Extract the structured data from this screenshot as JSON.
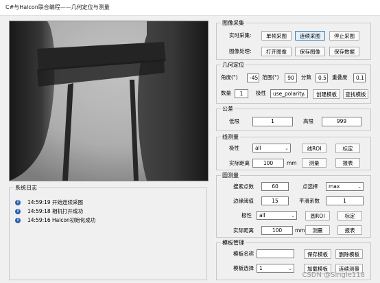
{
  "window": {
    "title": "C#与Halcon联合编程——几何定位与测量"
  },
  "log": {
    "title": "系统日志",
    "entries": [
      {
        "time": "14:59:19",
        "message": "开始连续采图"
      },
      {
        "time": "14:59:18",
        "message": "相机打开成功"
      },
      {
        "time": "14:59:16",
        "message": "Halcon初始化成功"
      }
    ]
  },
  "acquire": {
    "title": "图像采集",
    "realtime_label": "实时采集:",
    "single_btn": "单帧采图",
    "continuous_btn": "连续采图",
    "stop_btn": "停止采图",
    "process_label": "图像处理:",
    "open_btn": "打开图像",
    "save_img_btn": "保存图像",
    "save_data_btn": "保存数据"
  },
  "locate": {
    "title": "几何定位",
    "angle_label": "角度(°)",
    "angle_value": "-45",
    "range_label": "范围(°)",
    "range_value": "90",
    "score_label": "分数",
    "score_value": "0.5",
    "overlap_label": "重叠度",
    "overlap_value": "0.1",
    "count_label": "数量",
    "count_value": "1",
    "polarity_label": "极性",
    "polarity_value": "use_polarity",
    "create_btn": "创建模板",
    "find_btn": "查找模板"
  },
  "tolerance": {
    "title": "公差",
    "low_label": "低限",
    "low_value": "1",
    "high_label": "高限",
    "high_value": "999"
  },
  "line_measure": {
    "title": "线测量",
    "polarity_label": "极性",
    "polarity_value": "all",
    "roi_btn": "线ROI",
    "calib_btn": "标定",
    "dist_label": "实际距离",
    "dist_value": "100",
    "unit": "mm",
    "measure_btn": "测量",
    "report_btn": "报表"
  },
  "circle_measure": {
    "title": "圆测量",
    "points_label": "搜索点数",
    "points_value": "60",
    "select_label": "点选择",
    "select_value": "max",
    "threshold_label": "边缘阈值",
    "threshold_value": "15",
    "smooth_label": "平滑系数",
    "smooth_value": "1",
    "polarity_label": "极性",
    "polarity_value": "all",
    "roi_btn": "圆ROI",
    "calib_btn": "标定",
    "dist_label": "实际距离",
    "dist_value": "100",
    "unit": "mm",
    "measure_btn": "测量",
    "report_btn": "报表"
  },
  "template_mgmt": {
    "title": "模板管理",
    "name_label": "模板名称",
    "name_value": "",
    "save_btn": "保存模板",
    "delete_btn": "删除模板",
    "select_label": "模板选择",
    "select_value": "1",
    "load_btn": "加载模板",
    "cont_measure_btn": "连续测量"
  },
  "watermark": "CSDN @Single118",
  "colors": {
    "accent": "#3c7fb1",
    "info_icon": "#2b5fb3"
  }
}
